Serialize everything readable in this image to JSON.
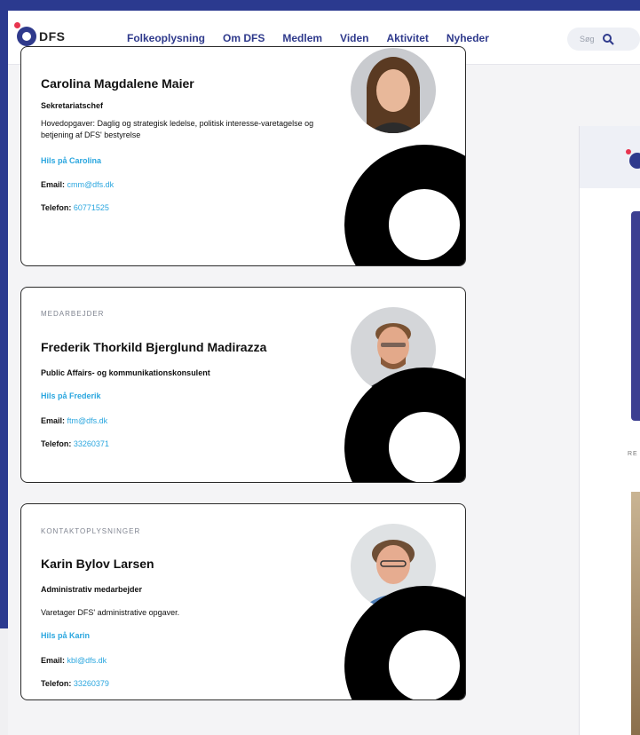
{
  "nav": {
    "logo_text": "DFS",
    "menu": [
      "Folkeoplysning",
      "Om DFS",
      "Medlem",
      "Viden",
      "Aktivitet",
      "Nyheder"
    ],
    "search_label": "Søg"
  },
  "cards": [
    {
      "label": "",
      "name": "Carolina Magdalene Maier",
      "role": "Sekretariatschef",
      "desc": "Hovedopgaver: Daglig og strategisk ledelse, politisk interesse-varetagelse og betjening af DFS' bestyrelse",
      "greet": "Hils på Carolina",
      "email_label": "Email:",
      "email": "cmm@dfs.dk",
      "phone_label": "Telefon:",
      "phone": "60771525"
    },
    {
      "label": "MEDARBEJDER",
      "name": "Frederik Thorkild Bjerglund Madirazza",
      "role": "Public Affairs- og kommunikationskonsulent",
      "greet": "Hils på Frederik",
      "email_label": "Email:",
      "email": "ftm@dfs.dk",
      "phone_label": "Telefon:",
      "phone": "33260371"
    },
    {
      "label": "KONTAKTOPLYSNINGER",
      "name": "Karin Bylov Larsen",
      "role": "Administrativ medarbejder",
      "desc": "Varetager DFS' administrative opgaver.",
      "greet": "Hils på Karin",
      "email_label": "Email:",
      "email": "kbl@dfs.dk",
      "phone_label": "Telefon:",
      "phone": "33260379"
    }
  ],
  "right": {
    "label": "RE"
  },
  "colors": {
    "brand": "#2f3a8c",
    "accent": "#e8344e",
    "link": "#2aa6df"
  }
}
